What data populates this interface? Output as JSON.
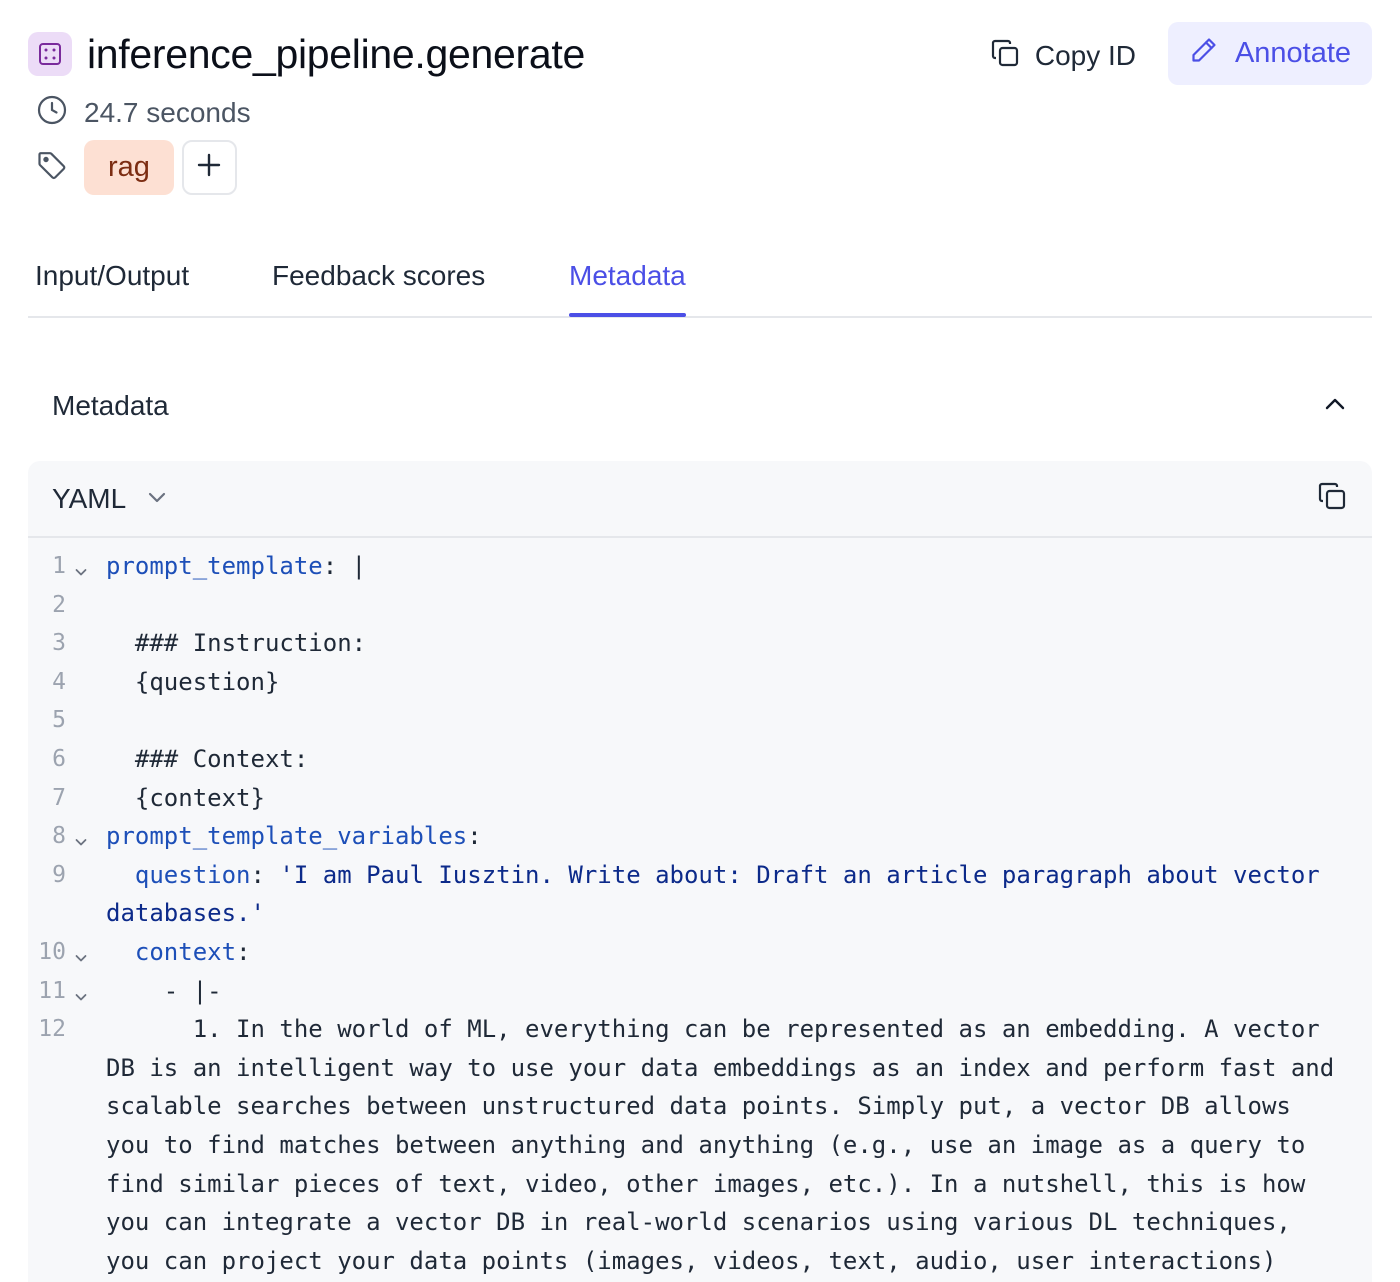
{
  "header": {
    "span_name": "inference_pipeline.generate",
    "copy_id_label": "Copy ID",
    "annotate_label": "Annotate",
    "duration": "24.7 seconds",
    "tags": [
      "rag"
    ]
  },
  "tabs": [
    {
      "label": "Input/Output",
      "active": false
    },
    {
      "label": "Feedback scores",
      "active": false
    },
    {
      "label": "Metadata",
      "active": true
    }
  ],
  "section": {
    "title": "Metadata",
    "expanded": true
  },
  "code_panel": {
    "format": "YAML",
    "lines": [
      {
        "n": "1",
        "fold": true,
        "indent": "",
        "key": "prompt_template",
        "text": ": |"
      },
      {
        "n": "2",
        "fold": false,
        "indent": "",
        "key": "",
        "text": ""
      },
      {
        "n": "3",
        "fold": false,
        "indent": "  ",
        "key": "",
        "text": "### Instruction:"
      },
      {
        "n": "4",
        "fold": false,
        "indent": "  ",
        "key": "",
        "text": "{question}"
      },
      {
        "n": "5",
        "fold": false,
        "indent": "",
        "key": "",
        "text": ""
      },
      {
        "n": "6",
        "fold": false,
        "indent": "  ",
        "key": "",
        "text": "### Context:"
      },
      {
        "n": "7",
        "fold": false,
        "indent": "  ",
        "key": "",
        "text": "{context}"
      },
      {
        "n": "8",
        "fold": true,
        "indent": "",
        "key": "prompt_template_variables",
        "text": ":"
      },
      {
        "n": "9",
        "fold": false,
        "indent": "  ",
        "key": "question",
        "text": ": ",
        "string": "'I am Paul Iusztin. Write about: Draft an article paragraph about vector databases.'"
      },
      {
        "n": "10",
        "fold": true,
        "indent": "  ",
        "key": "context",
        "text": ":"
      },
      {
        "n": "11",
        "fold": true,
        "indent": "    ",
        "key": "",
        "text": "- |-"
      },
      {
        "n": "12",
        "fold": false,
        "indent": "      ",
        "key": "",
        "text": "1. In the world of ML, everything can be represented as an embedding. A vector DB is an intelligent way to use your data embeddings as an index and perform fast and scalable searches between unstructured data points. Simply put, a vector DB allows you to find matches between anything and anything (e.g., use an image as a query to find similar pieces of text, video, other images, etc.). In a nutshell, this is how you can integrate a vector DB in real-world scenarios using various DL techniques, you can project your data points (images, videos, text, audio, user interactions) into the same"
      }
    ]
  }
}
